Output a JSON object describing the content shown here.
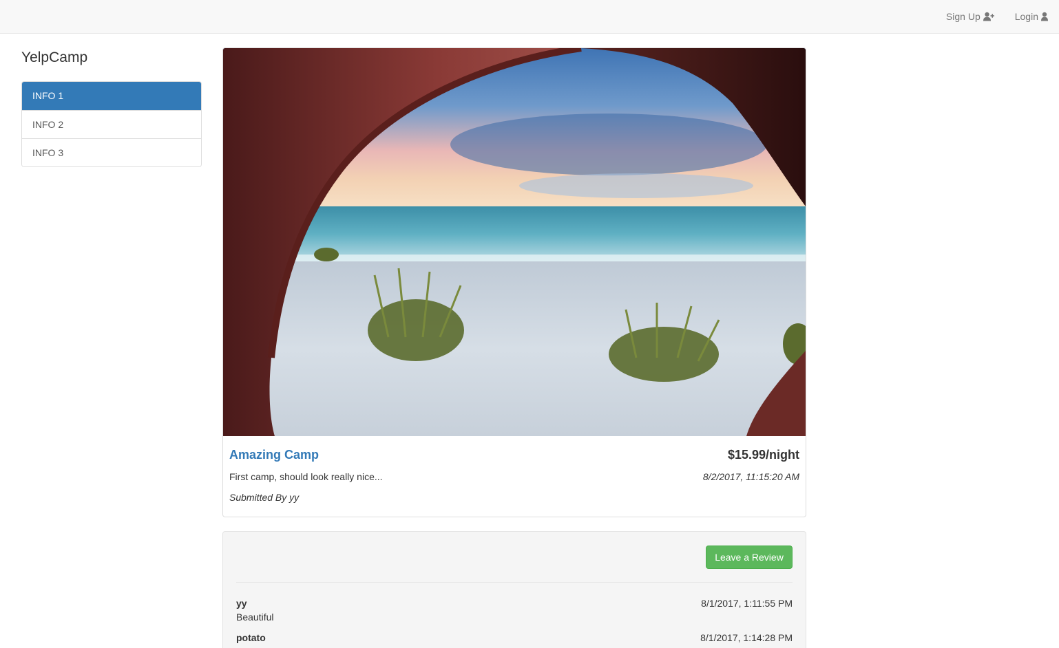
{
  "navbar": {
    "signup_label": "Sign Up",
    "login_label": "Login"
  },
  "sidebar": {
    "title": "YelpCamp",
    "items": [
      {
        "label": "INFO 1",
        "active": true
      },
      {
        "label": "INFO 2",
        "active": false
      },
      {
        "label": "INFO 3",
        "active": false
      }
    ]
  },
  "campground": {
    "name": "Amazing Camp",
    "price": "$15.99/night",
    "description": "First camp, should look really nice...",
    "date": "8/2/2017, 11:15:20 AM",
    "submitted_by": "Submitted By yy"
  },
  "reviews": {
    "button_label": "Leave a Review",
    "items": [
      {
        "author": "yy",
        "date": "8/1/2017, 1:11:55 PM",
        "text": "Beautiful"
      },
      {
        "author": "potato",
        "date": "8/1/2017, 1:14:28 PM",
        "text": ""
      }
    ]
  },
  "colors": {
    "primary": "#337ab7",
    "success": "#5cb85c",
    "navbar_bg": "#f8f8f8"
  }
}
